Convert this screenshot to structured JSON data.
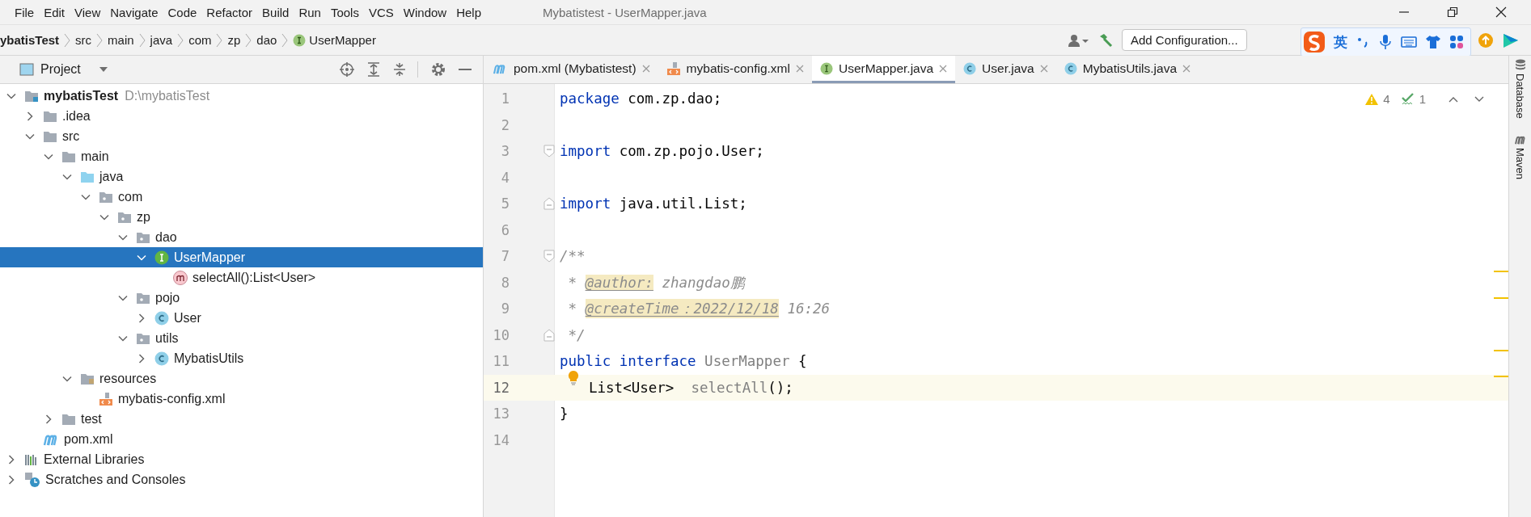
{
  "menu": {
    "items": [
      {
        "label": "File"
      },
      {
        "label": "Edit"
      },
      {
        "label": "View"
      },
      {
        "label": "Navigate"
      },
      {
        "label": "Code"
      },
      {
        "label": "Refactor"
      },
      {
        "label": "Build"
      },
      {
        "label": "Run"
      },
      {
        "label": "Tools"
      },
      {
        "label": "VCS"
      },
      {
        "label": "Window"
      },
      {
        "label": "Help"
      }
    ]
  },
  "window": {
    "title": "Mybatistest - UserMapper.java"
  },
  "breadcrumb": [
    {
      "label": "ybatisTest",
      "kind": "project"
    },
    {
      "label": "src",
      "kind": "folder"
    },
    {
      "label": "main",
      "kind": "folder"
    },
    {
      "label": "java",
      "kind": "folder"
    },
    {
      "label": "com",
      "kind": "folder"
    },
    {
      "label": "zp",
      "kind": "folder"
    },
    {
      "label": "dao",
      "kind": "folder"
    },
    {
      "label": "UserMapper",
      "kind": "interface"
    }
  ],
  "toolbar": {
    "run_config": "Add Configuration..."
  },
  "ime": {
    "mode": "英"
  },
  "project_panel": {
    "title": "Project",
    "tree": [
      {
        "label": "mybatisTest",
        "path": "D:\\mybatisTest",
        "kind": "module",
        "expanded": true,
        "selected": false,
        "children": [
          {
            "label": ".idea",
            "kind": "folder",
            "expanded": false,
            "selected": false
          },
          {
            "label": "src",
            "kind": "folder",
            "expanded": true,
            "selected": false,
            "children": [
              {
                "label": "main",
                "kind": "folder",
                "expanded": true,
                "selected": false,
                "children": [
                  {
                    "label": "java",
                    "kind": "source-folder",
                    "expanded": true,
                    "selected": false,
                    "children": [
                      {
                        "label": "com",
                        "kind": "package",
                        "expanded": true,
                        "selected": false,
                        "children": [
                          {
                            "label": "zp",
                            "kind": "package",
                            "expanded": true,
                            "selected": false,
                            "children": [
                              {
                                "label": "dao",
                                "kind": "package",
                                "expanded": true,
                                "selected": false,
                                "children": [
                                  {
                                    "label": "UserMapper",
                                    "kind": "interface",
                                    "expanded": true,
                                    "selected": true,
                                    "children": [
                                      {
                                        "label": "selectAll():List<User>",
                                        "kind": "method",
                                        "selected": false
                                      }
                                    ]
                                  }
                                ]
                              },
                              {
                                "label": "pojo",
                                "kind": "package",
                                "expanded": true,
                                "selected": false,
                                "children": [
                                  {
                                    "label": "User",
                                    "kind": "class",
                                    "expanded": false,
                                    "selected": false
                                  }
                                ]
                              },
                              {
                                "label": "utils",
                                "kind": "package",
                                "expanded": true,
                                "selected": false,
                                "children": [
                                  {
                                    "label": "MybatisUtils",
                                    "kind": "class",
                                    "expanded": false,
                                    "selected": false
                                  }
                                ]
                              }
                            ]
                          }
                        ]
                      }
                    ]
                  },
                  {
                    "label": "resources",
                    "kind": "resources-folder",
                    "expanded": true,
                    "selected": false,
                    "children": [
                      {
                        "label": "mybatis-config.xml",
                        "kind": "xml",
                        "selected": false
                      }
                    ]
                  }
                ]
              },
              {
                "label": "test",
                "kind": "folder",
                "expanded": false,
                "selected": false
              }
            ]
          },
          {
            "label": "pom.xml",
            "kind": "maven",
            "selected": false
          }
        ]
      },
      {
        "label": "External Libraries",
        "kind": "libraries",
        "expanded": false,
        "selected": false
      },
      {
        "label": "Scratches and Consoles",
        "kind": "scratches",
        "expanded": false,
        "selected": false
      }
    ]
  },
  "editor_tabs": [
    {
      "label": "pom.xml (Mybatistest)",
      "kind": "maven",
      "selected": false
    },
    {
      "label": "mybatis-config.xml",
      "kind": "xml",
      "selected": false
    },
    {
      "label": "UserMapper.java",
      "kind": "interface",
      "selected": true
    },
    {
      "label": "User.java",
      "kind": "class",
      "selected": false
    },
    {
      "label": "MybatisUtils.java",
      "kind": "class",
      "selected": false
    }
  ],
  "inspections": {
    "warnings": "4",
    "typos": "1"
  },
  "code": [
    {
      "number": "1",
      "kind": "plain",
      "current": false,
      "tokens": [
        {
          "text": "package",
          "kind": "keyword"
        },
        {
          "text": " com.zp.dao;",
          "kind": "plain"
        }
      ]
    },
    {
      "number": "2",
      "kind": "plain",
      "current": false
    },
    {
      "number": "3",
      "kind": "fold-start",
      "current": false,
      "tokens": [
        {
          "text": "import",
          "kind": "keyword"
        },
        {
          "text": " com.zp.pojo.User;",
          "kind": "plain"
        }
      ]
    },
    {
      "number": "4",
      "kind": "plain",
      "current": false
    },
    {
      "number": "5",
      "kind": "fold-end",
      "current": false,
      "tokens": [
        {
          "text": "import",
          "kind": "keyword"
        },
        {
          "text": " java.util.List;",
          "kind": "plain"
        }
      ]
    },
    {
      "number": "6",
      "kind": "plain",
      "current": false
    },
    {
      "number": "7",
      "kind": "fold-start",
      "current": false,
      "tokens": [
        {
          "text": "/**",
          "kind": "comment"
        }
      ]
    },
    {
      "number": "8",
      "kind": "plain",
      "current": false,
      "tokens": [
        {
          "text": " * ",
          "kind": "comment"
        },
        {
          "text": "@author:",
          "kind": "doc-tag"
        },
        {
          "text": " zhangdao鹏",
          "kind": "comment"
        }
      ]
    },
    {
      "number": "9",
      "kind": "plain",
      "current": false,
      "tokens": [
        {
          "text": " * ",
          "kind": "comment"
        },
        {
          "text": "@createTime：2022/12/18",
          "kind": "doc-tag"
        },
        {
          "text": " 16:26",
          "kind": "comment"
        }
      ]
    },
    {
      "number": "10",
      "kind": "fold-end",
      "current": false,
      "tokens": [
        {
          "text": " */",
          "kind": "comment"
        }
      ]
    },
    {
      "number": "11",
      "kind": "plain",
      "current": false,
      "tokens": [
        {
          "text": "public",
          "kind": "keyword"
        },
        {
          "text": " interface",
          "kind": "keyword"
        },
        {
          "text": " UserMapper",
          "kind": "unused"
        },
        {
          "text": " {",
          "kind": "plain"
        }
      ]
    },
    {
      "number": "12",
      "kind": "plain",
      "current": true,
      "indented": true,
      "bulb": true,
      "tokens": [
        {
          "text": "List<User>",
          "kind": "plain"
        },
        {
          "text": "  selectAll",
          "kind": "unused"
        },
        {
          "text": "();",
          "kind": "plain"
        }
      ]
    },
    {
      "number": "13",
      "kind": "plain",
      "current": false,
      "tokens": [
        {
          "text": "}",
          "kind": "plain"
        }
      ]
    },
    {
      "number": "14",
      "kind": "plain",
      "current": false
    }
  ],
  "right_stripe": [
    {
      "label": "Database",
      "kind": "database"
    },
    {
      "label": "Maven",
      "kind": "maven"
    }
  ]
}
